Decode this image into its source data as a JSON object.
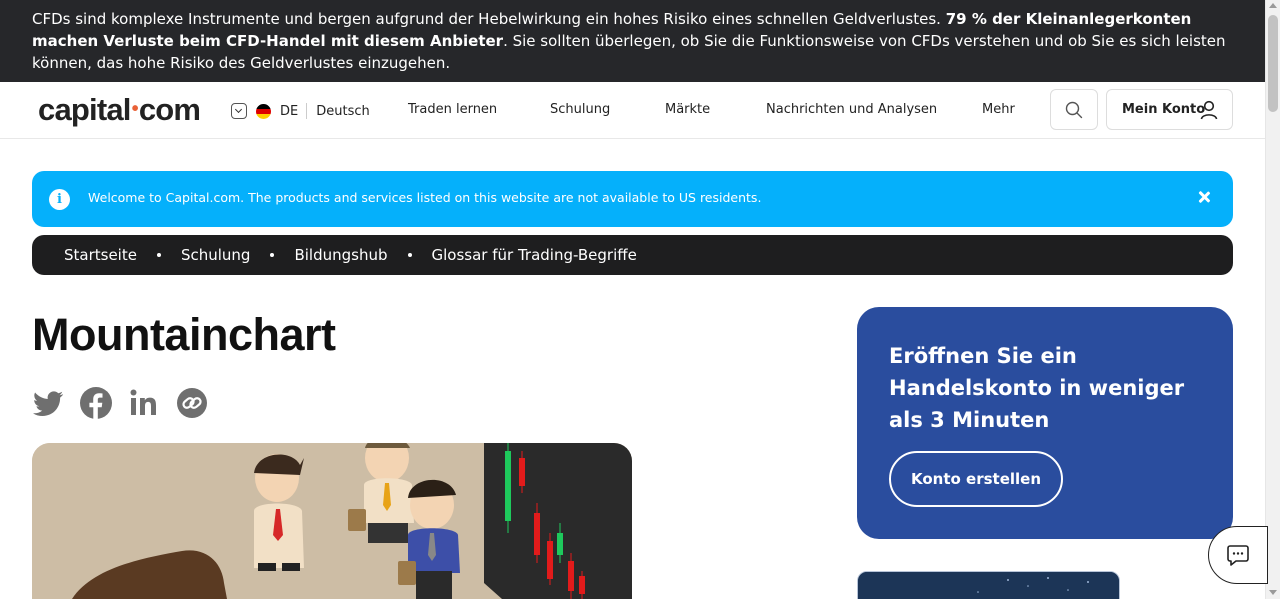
{
  "risk_warning": {
    "part1": "CFDs sind komplexe Instrumente und bergen aufgrund der Hebelwirkung ein hohes Risiko eines schnellen Geldverlustes. ",
    "bold": "79 % der Kleinanlegerkonten machen Verluste beim CFD-Handel mit diesem Anbieter",
    "part2": ". Sie sollten überlegen, ob Sie die Funktionsweise von CFDs verstehen und ob Sie es sich leisten können, das hohe Risiko des Geldverlustes einzugehen."
  },
  "header": {
    "logo_left": "capital",
    "logo_dot": "•",
    "logo_right": "com",
    "lang_code": "DE",
    "lang_name": "Deutsch",
    "nav": [
      "Traden lernen",
      "Schulung",
      "Märkte",
      "Nachrichten und Analysen",
      "Mehr"
    ],
    "account_label": "Mein Konto"
  },
  "notice": {
    "icon": "i",
    "text": "Welcome to Capital.com. The products and services listed on this website are not available to US residents."
  },
  "breadcrumb": [
    "Startseite",
    "Schulung",
    "Bildungshub",
    "Glossar für Trading-Begriffe"
  ],
  "page": {
    "title": "Mountainchart",
    "share_icons": [
      "twitter-icon",
      "facebook-icon",
      "linkedin-icon",
      "copy-link-icon"
    ]
  },
  "cta_card": {
    "title": "Eröffnen Sie ein Handelskonto in weniger als 3 Minuten",
    "button": "Konto erstellen"
  },
  "colors": {
    "risk_bg": "#26272a",
    "notice_bg": "#05b0fb",
    "card_bg": "#2a4d9e",
    "breadcrumb_bg": "#1e1e1f",
    "accent": "#e96137"
  }
}
